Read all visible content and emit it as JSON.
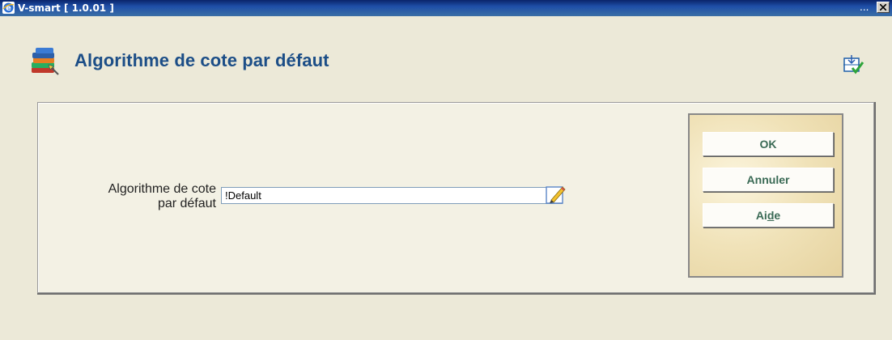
{
  "window": {
    "title": "V-smart [ 1.0.01 ]",
    "ellipsis": "...",
    "close_icon": "close-x-icon"
  },
  "page": {
    "title": "Algorithme de cote par défaut",
    "header_icon": "books-icon",
    "corner_icon": "screen-layout-check-icon"
  },
  "form": {
    "label_line1": "Algorithme de cote",
    "label_line2": "par défaut",
    "select_value": "!Default",
    "edit_icon": "pencil-edit-icon"
  },
  "buttons": {
    "ok": "OK",
    "cancel": "Annuler",
    "help_prefix": "Ai",
    "help_mnemonic": "d",
    "help_suffix": "e"
  },
  "colors": {
    "title_text": "#1c4e87",
    "button_text": "#3a6a55",
    "background": "#ece9d8"
  }
}
